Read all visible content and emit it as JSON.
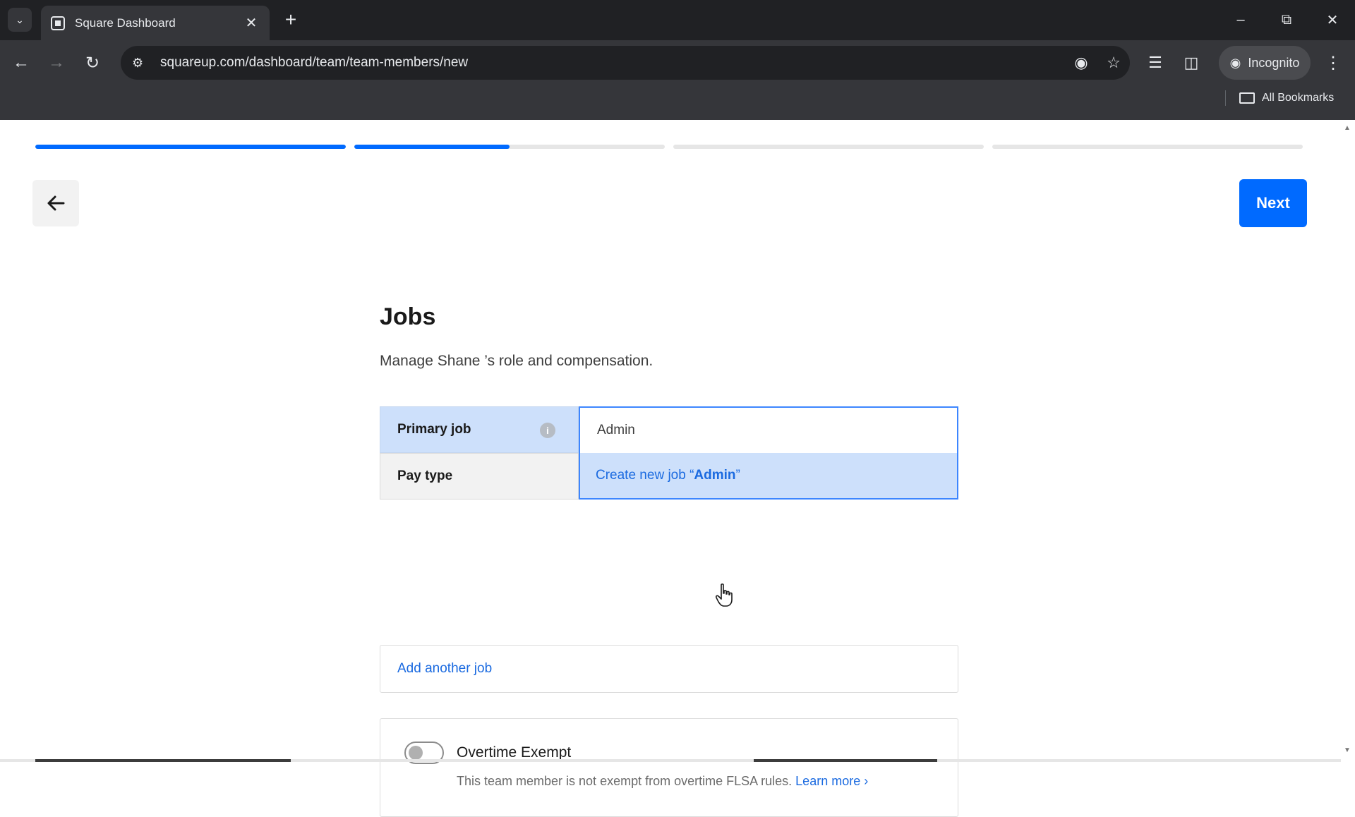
{
  "browser": {
    "tab_title": "Square Dashboard",
    "url": "squareup.com/dashboard/team/team-members/new",
    "incognito_label": "Incognito",
    "bookmarks_label": "All Bookmarks"
  },
  "progress": {
    "steps": [
      {
        "fill": 1.0
      },
      {
        "fill": 0.5
      },
      {
        "fill": 0.0
      },
      {
        "fill": 0.0
      }
    ],
    "accent_color": "#006aff"
  },
  "header": {
    "next_label": "Next"
  },
  "jobs": {
    "title": "Jobs",
    "subtitle": "Manage Shane ’s role and compensation.",
    "primary_job_label": "Primary job",
    "primary_job_value": "Admin",
    "pay_type_label": "Pay type",
    "create_option_prefix": "Create new job “",
    "create_option_match": "Admin",
    "create_option_suffix": "”",
    "add_another_job": "Add another job"
  },
  "overtime": {
    "title": "Overtime Exempt",
    "description": "This team member is not exempt from overtime FLSA rules.",
    "learn_more": "Learn more",
    "enabled": false
  }
}
